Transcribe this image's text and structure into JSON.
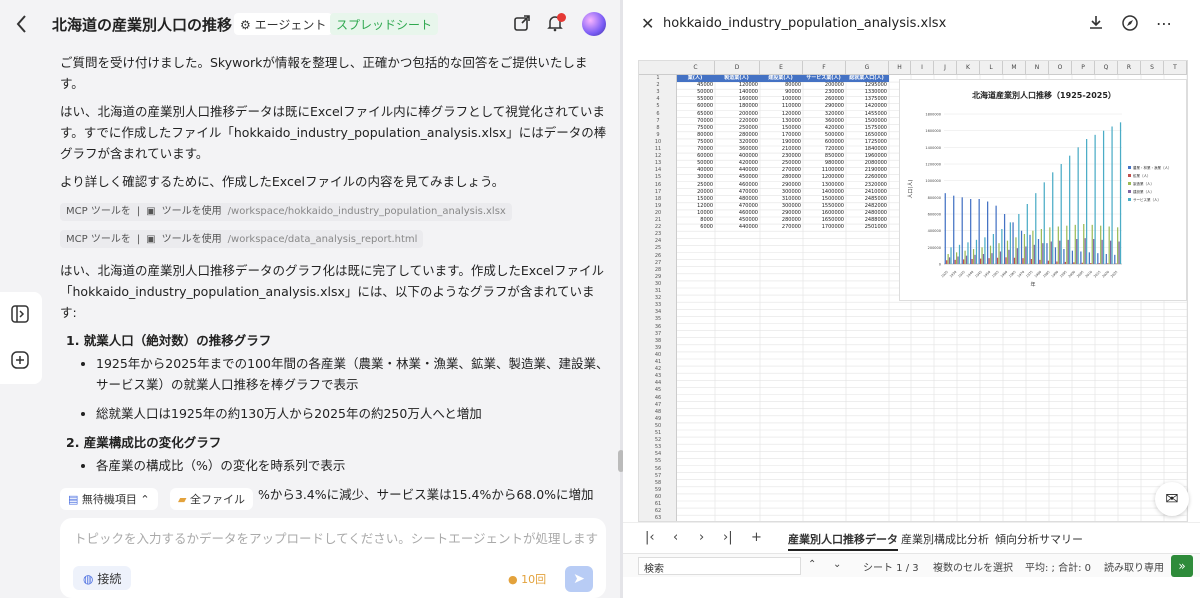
{
  "header": {
    "back_icon": "chevron-left-icon",
    "title": "北海道の産業別人口の推移",
    "agent_tag": "エージェント",
    "sheet_tag": "スプレッドシート"
  },
  "messages": {
    "p1": "ご質問を受け付けました。Skyworkが情報を整理し、正確かつ包括的な回答をご提供いたします。",
    "p2": "はい、北海道の産業別人口推移データは既にExcelファイル内に棒グラフとして視覚化されています。すでに作成したファイル「hokkaido_industry_population_analysis.xlsx」にはデータの棒グラフが含まれています。",
    "p3": "より詳しく確認するために、作成したExcelファイルの内容を見てみましょう。",
    "tool1_label": "MCP ツールを",
    "tool1_action": "ツールを使用",
    "tool1_path": "/workspace/hokkaido_industry_population_analysis.xlsx",
    "tool2_label": "MCP ツールを",
    "tool2_action": "ツールを使用",
    "tool2_path": "/workspace/data_analysis_report.html",
    "p4": "はい、北海道の産業別人口推移データのグラフ化は既に完了しています。作成したExcelファイル「hokkaido_industry_population_analysis.xlsx」には、以下のようなグラフが含まれています:",
    "h1": "1. 就業人口（絶対数）の推移グラフ",
    "li1": "1925年から2025年までの100年間の各産業（農業・林業・漁業、鉱業、製造業、建設業、サービス業）の就業人口推移を棒グラフで表示",
    "li2": "総就業人口は1925年の約130万人から2025年の約250万人へと増加",
    "h2": "2. 産業構成比の変化グラフ",
    "li3": "各産業の構成比（%）の変化を時系列で表示",
    "li4_tail": "%から3.4%に減少、サービス業は15.4%から68.0%に増加"
  },
  "chips": {
    "pending": "無待機項目",
    "files": "全ファイル"
  },
  "input": {
    "placeholder": "トピックを入力するかデータをアップロードしてください。シートエージェントが処理します",
    "connect": "接続",
    "credits": "10回"
  },
  "file": {
    "name": "hokkaido_industry_population_analysis.xlsx"
  },
  "sheet": {
    "columns": [
      "C",
      "D",
      "E",
      "F",
      "G",
      "H",
      "I",
      "J",
      "K",
      "L",
      "M",
      "N",
      "O",
      "P",
      "Q",
      "R",
      "S",
      "T"
    ],
    "headers": [
      "業(人)",
      "製造業(人)",
      "建設業(人)",
      "サービス業(人)",
      "総就業人口(人)"
    ],
    "rows": [
      [
        "45000",
        "120000",
        "80000",
        "200000",
        "1295000"
      ],
      [
        "50000",
        "140000",
        "90000",
        "230000",
        "1330000"
      ],
      [
        "55000",
        "160000",
        "100000",
        "260000",
        "1375000"
      ],
      [
        "60000",
        "180000",
        "110000",
        "290000",
        "1420000"
      ],
      [
        "65000",
        "200000",
        "120000",
        "320000",
        "1455000"
      ],
      [
        "70000",
        "220000",
        "130000",
        "360000",
        "1500000"
      ],
      [
        "75000",
        "250000",
        "150000",
        "420000",
        "1575000"
      ],
      [
        "80000",
        "280000",
        "170000",
        "500000",
        "1650000"
      ],
      [
        "75000",
        "320000",
        "190000",
        "600000",
        "1725000"
      ],
      [
        "70000",
        "360000",
        "210000",
        "720000",
        "1840000"
      ],
      [
        "60000",
        "400000",
        "230000",
        "850000",
        "1960000"
      ],
      [
        "50000",
        "420000",
        "250000",
        "980000",
        "2080000"
      ],
      [
        "40000",
        "440000",
        "270000",
        "1100000",
        "2190000"
      ],
      [
        "30000",
        "450000",
        "280000",
        "1200000",
        "2260000"
      ],
      [
        "25000",
        "460000",
        "290000",
        "1300000",
        "2320000"
      ],
      [
        "20000",
        "470000",
        "300000",
        "1400000",
        "2410000"
      ],
      [
        "15000",
        "480000",
        "310000",
        "1500000",
        "2485000"
      ],
      [
        "12000",
        "470000",
        "300000",
        "1550000",
        "2482000"
      ],
      [
        "10000",
        "460000",
        "290000",
        "1600000",
        "2480000"
      ],
      [
        "8000",
        "450000",
        "280000",
        "1650000",
        "2488000"
      ],
      [
        "6000",
        "440000",
        "270000",
        "1700000",
        "2501000"
      ]
    ]
  },
  "chart_data": {
    "type": "bar",
    "title": "北海道産業別人口推移（1925-2025）",
    "xlabel": "年",
    "ylabel": "人口(人)",
    "ylim": [
      0,
      1800000
    ],
    "yticks": [
      "0",
      "200000",
      "400000",
      "600000",
      "800000",
      "1000000",
      "1200000",
      "1400000",
      "1600000",
      "1800000"
    ],
    "categories": [
      "1925",
      "1930",
      "1935",
      "1940",
      "1945",
      "1950",
      "1955",
      "1960",
      "1965",
      "1970",
      "1975",
      "1980",
      "1985",
      "1990",
      "1995",
      "2000",
      "2005",
      "2010",
      "2015",
      "2020",
      "2025"
    ],
    "legend_position": "right",
    "series": [
      {
        "name": "農業・林業・漁業（人）",
        "color": "#4472c4",
        "values": [
          850000,
          820000,
          800000,
          780000,
          780000,
          750000,
          700000,
          600000,
          500000,
          400000,
          350000,
          300000,
          250000,
          200000,
          180000,
          160000,
          150000,
          140000,
          130000,
          120000,
          110000
        ]
      },
      {
        "name": "鉱業（人）",
        "color": "#c0504d",
        "values": [
          45000,
          50000,
          55000,
          60000,
          65000,
          70000,
          75000,
          80000,
          75000,
          70000,
          60000,
          50000,
          40000,
          30000,
          25000,
          20000,
          15000,
          12000,
          10000,
          8000,
          6000
        ]
      },
      {
        "name": "製造業（人）",
        "color": "#9bbb59",
        "values": [
          120000,
          140000,
          160000,
          180000,
          200000,
          220000,
          250000,
          280000,
          320000,
          360000,
          400000,
          420000,
          440000,
          450000,
          460000,
          470000,
          480000,
          470000,
          460000,
          450000,
          440000
        ]
      },
      {
        "name": "建設業（人）",
        "color": "#8064a2",
        "values": [
          80000,
          90000,
          100000,
          110000,
          120000,
          130000,
          150000,
          170000,
          190000,
          210000,
          230000,
          250000,
          270000,
          280000,
          290000,
          300000,
          310000,
          300000,
          290000,
          280000,
          270000
        ]
      },
      {
        "name": "サービス業（人）",
        "color": "#4bacc6",
        "values": [
          200000,
          230000,
          260000,
          290000,
          320000,
          360000,
          420000,
          500000,
          600000,
          720000,
          850000,
          980000,
          1100000,
          1200000,
          1300000,
          1400000,
          1500000,
          1550000,
          1600000,
          1650000,
          1700000
        ]
      }
    ]
  },
  "sheet_tabs": [
    "産業別人口推移データ",
    "産業別構成比分析",
    "傾向分析サマリー"
  ],
  "statusbar": {
    "search": "検索",
    "sheet": "シート 1 / 3",
    "select": "複数のセルを選択",
    "avg": "平均: ; 合計: 0",
    "readonly": "読み取り専用"
  }
}
